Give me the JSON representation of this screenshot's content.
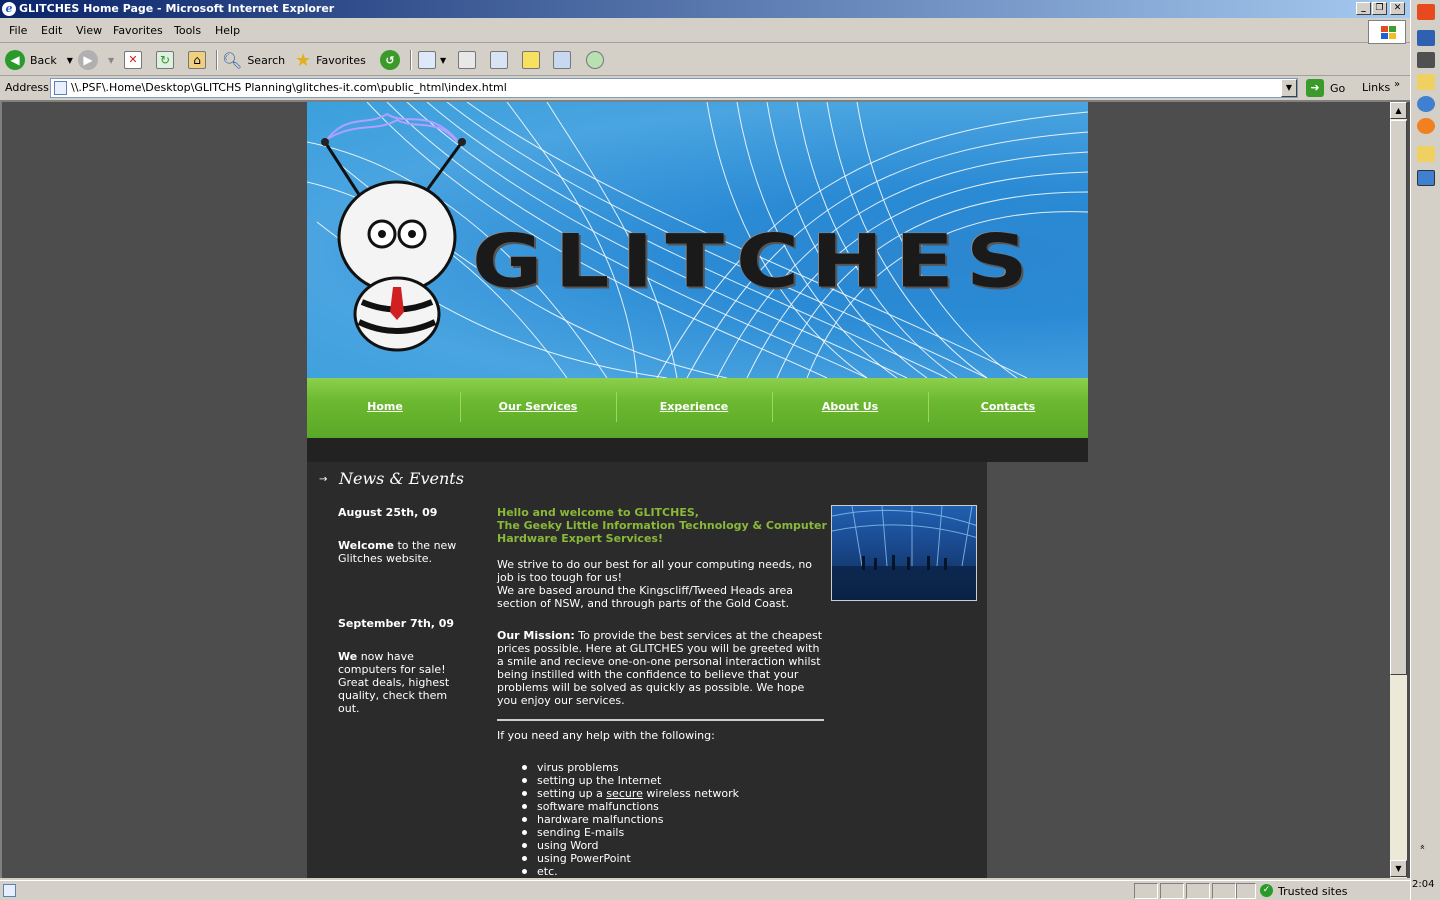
{
  "window": {
    "title": "GLITCHES Home Page - Microsoft Internet Explorer"
  },
  "menu": [
    "File",
    "Edit",
    "View",
    "Favorites",
    "Tools",
    "Help"
  ],
  "toolbar": {
    "back": "Back",
    "search": "Search",
    "favorites": "Favorites"
  },
  "address": {
    "label": "Address",
    "url": "\\\\.PSF\\.Home\\Desktop\\GLITCHS Planning\\glitches-it.com\\public_html\\index.html",
    "go": "Go",
    "links": "Links",
    "links_more": "»"
  },
  "site": {
    "logo_text": "GLITCHES",
    "nav": [
      "Home",
      "Our Services",
      "Experience",
      "About Us",
      "Contacts"
    ],
    "news_heading": "News & Events",
    "news": [
      {
        "date": "August 25th, 09",
        "lead": "Welcome",
        "body": " to the new Glitches website."
      },
      {
        "date": "September 7th, 09",
        "lead": "We",
        "body": " now have computers for sale! Great deals, highest quality, check them out."
      }
    ],
    "welcome": [
      "Hello and welcome to GLITCHES,",
      "The Geeky Little Information Technology & Computer Hardware Expert Services!"
    ],
    "intro": [
      "We strive to do our best for all your computing needs, no job is too tough for us!",
      "We are based around the Kingscliff/Tweed Heads area section of NSW, and through parts of the Gold Coast."
    ],
    "mission_label": "Our Mission:",
    "mission_text": " To provide the best services at the cheapest prices possible. Here at GLITCHES you will be greeted with a smile and recieve one-on-one personal interaction whilst being instilled with the confidence to believe that your problems will be solved as quickly as possible. We hope you enjoy our services.",
    "help_intro": "If you need any help with the following:",
    "help_items": [
      "virus problems",
      "setting up the Internet",
      "setting up a |secure| wireless network",
      "software malfunctions",
      "hardware malfunctions",
      "sending E-mails",
      "using Word",
      "using PowerPoint",
      "etc."
    ]
  },
  "status": {
    "zone": "Trusted sites"
  },
  "taskbar": {
    "time": "2:04",
    "expand": "»"
  }
}
